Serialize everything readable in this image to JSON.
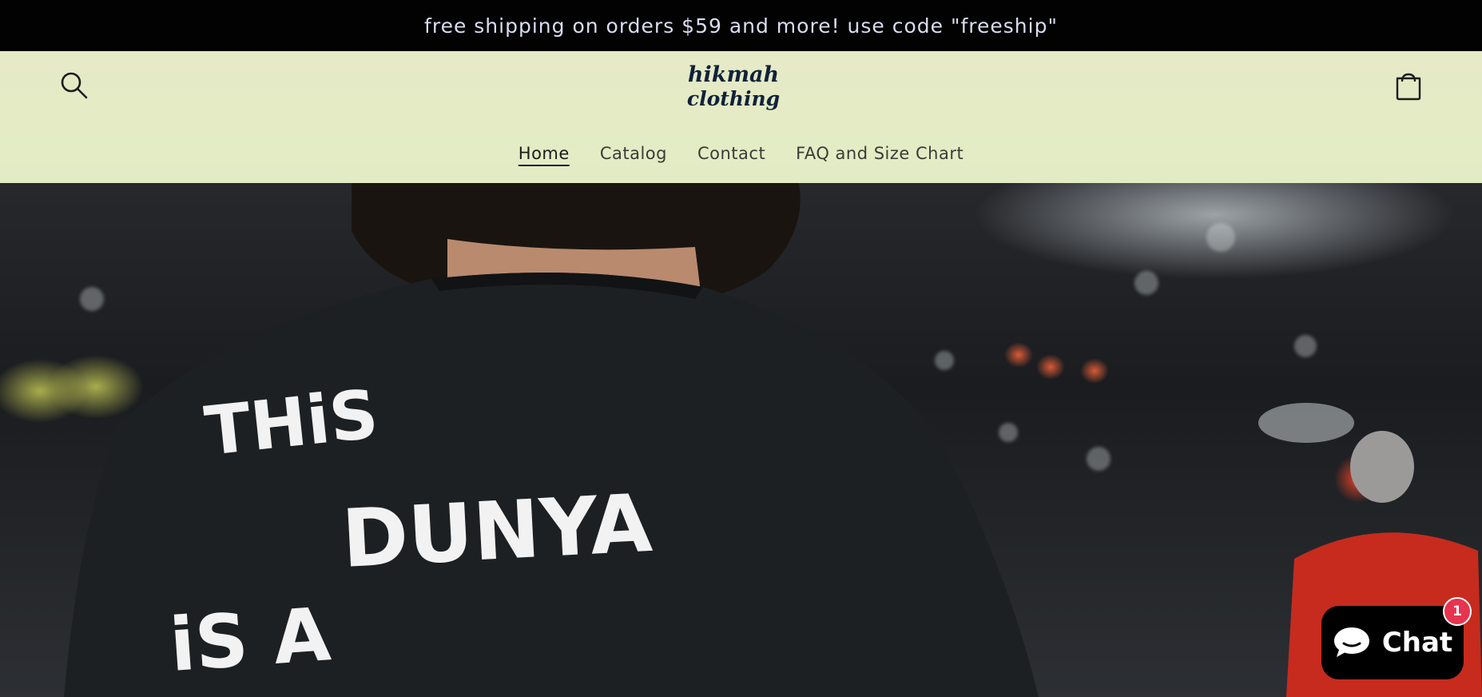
{
  "announcement": {
    "text": "free shipping on orders $59 and more! use code \"freeship\""
  },
  "header": {
    "logo_text_line1": "hikmah",
    "logo_text_line2": "clothing",
    "search_icon": "search-icon",
    "cart_icon": "bag-icon"
  },
  "nav": {
    "items": [
      {
        "label": "Home",
        "active": true
      },
      {
        "label": "Catalog",
        "active": false
      },
      {
        "label": "Contact",
        "active": false
      },
      {
        "label": "FAQ and Size Chart",
        "active": false
      }
    ]
  },
  "hero": {
    "shirt_text_line1": "THiS",
    "shirt_text_line2": "DUNYA",
    "shirt_text_line3": "iS A"
  },
  "chat": {
    "label": "Chat",
    "badge_count": "1",
    "icon": "chat-bubble-icon"
  },
  "colors": {
    "announcement_bg": "#020202",
    "header_bg": "#e4ebc5",
    "chat_bg": "#000000",
    "badge_red": "#e8334f"
  }
}
